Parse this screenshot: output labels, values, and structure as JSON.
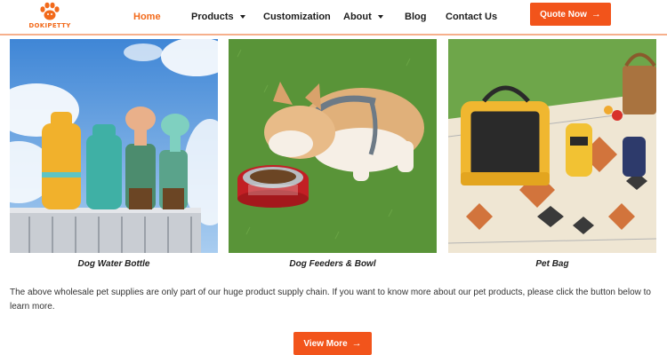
{
  "brand": {
    "logo_text": "DOKIPETTY"
  },
  "nav": {
    "items": [
      {
        "label": "Home",
        "active": true,
        "dropdown": false
      },
      {
        "label": "Products",
        "active": false,
        "dropdown": true
      },
      {
        "label": "Customization",
        "active": false,
        "dropdown": false
      },
      {
        "label": "About",
        "active": false,
        "dropdown": true
      },
      {
        "label": "Blog",
        "active": false,
        "dropdown": false
      },
      {
        "label": "Contact Us",
        "active": false,
        "dropdown": false
      }
    ],
    "quote_label": "Quote Now",
    "arrow_glyph": "→"
  },
  "products": [
    {
      "caption": "Dog Water Bottle",
      "image": "dog-water-bottles-photo"
    },
    {
      "caption": "Dog Feeders & Bowl",
      "image": "corgi-eating-from-bowl-photo"
    },
    {
      "caption": "Pet Bag",
      "image": "pet-carrier-bag-on-blanket-photo"
    }
  ],
  "description": "The above wholesale pet supplies are only part of our huge product supply chain. If you want to know more about our pet products, please click the button below to learn more.",
  "view_more_label": "View More",
  "colors": {
    "accent": "#f26a1b",
    "button": "#f2541b",
    "header_border": "#f6b08c"
  }
}
